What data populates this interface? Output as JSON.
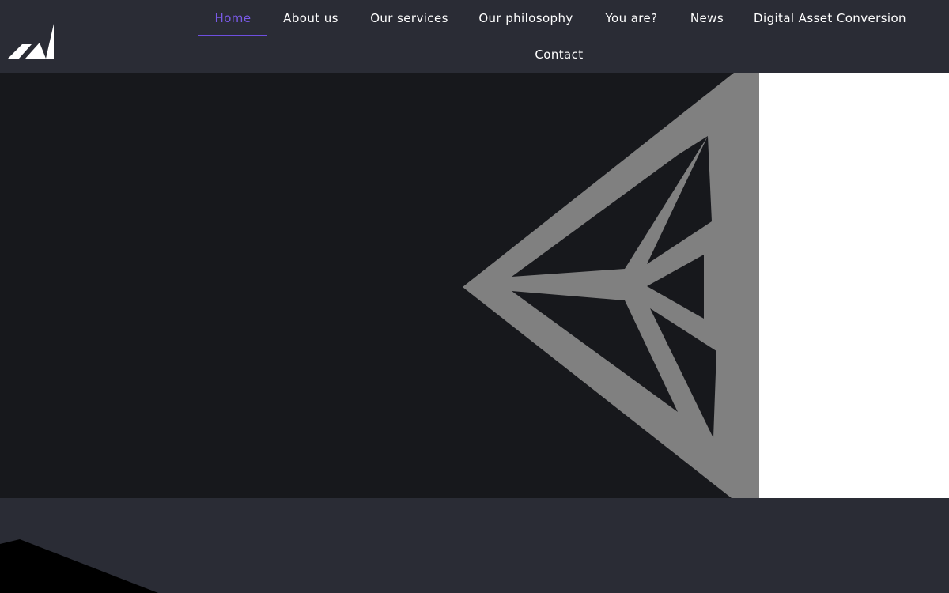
{
  "brand": {
    "logo_icon": "mountain-logo-icon",
    "logo_color": "#ffffff"
  },
  "nav": {
    "items": [
      {
        "label": "Home",
        "active": true
      },
      {
        "label": "About us"
      },
      {
        "label": "Our services"
      },
      {
        "label": "Our philosophy"
      },
      {
        "label": "You are?"
      },
      {
        "label": "News"
      },
      {
        "label": "Digital Asset Conversion"
      },
      {
        "label": "Contact"
      }
    ]
  },
  "colors": {
    "header_bg": "#2a2c35",
    "hero_bg": "#17181c",
    "accent": "#7a5ae8",
    "emblem": "#808080",
    "bottom_shape": "#000000"
  },
  "hero": {
    "emblem_icon": "tron-triangle-icon"
  }
}
